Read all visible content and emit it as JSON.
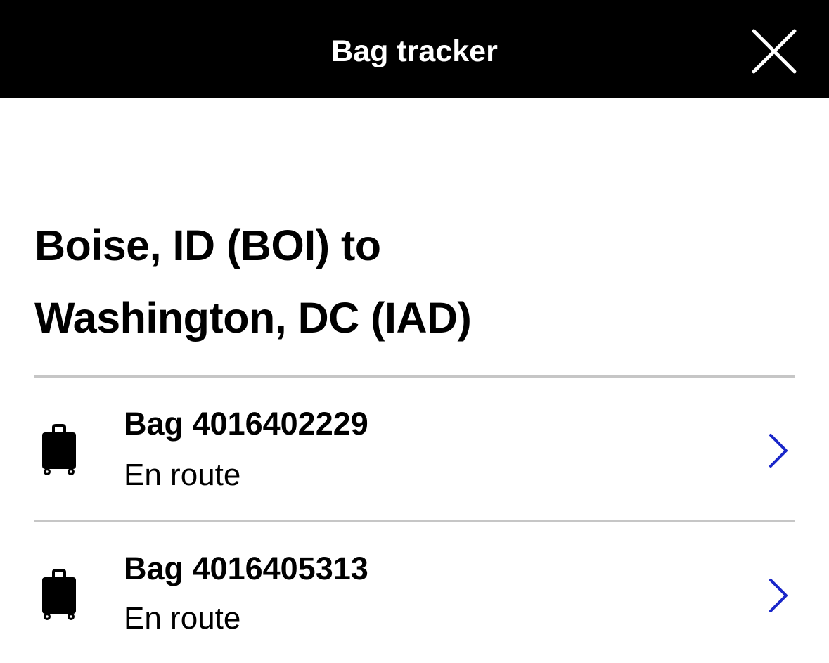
{
  "header": {
    "title": "Bag tracker",
    "close_icon": "close-icon"
  },
  "trip": {
    "route_line1": "Boise, ID (BOI) to",
    "route_line2": "Washington, DC (IAD)"
  },
  "bags": [
    {
      "label": "Bag 4016402229",
      "status": "En route",
      "icon": "luggage-icon"
    },
    {
      "label": "Bag 4016405313",
      "status": "En route",
      "icon": "luggage-icon"
    }
  ],
  "colors": {
    "header_bg": "#000000",
    "header_text": "#ffffff",
    "divider": "#c6c6c6",
    "chevron": "#1a27c9"
  }
}
